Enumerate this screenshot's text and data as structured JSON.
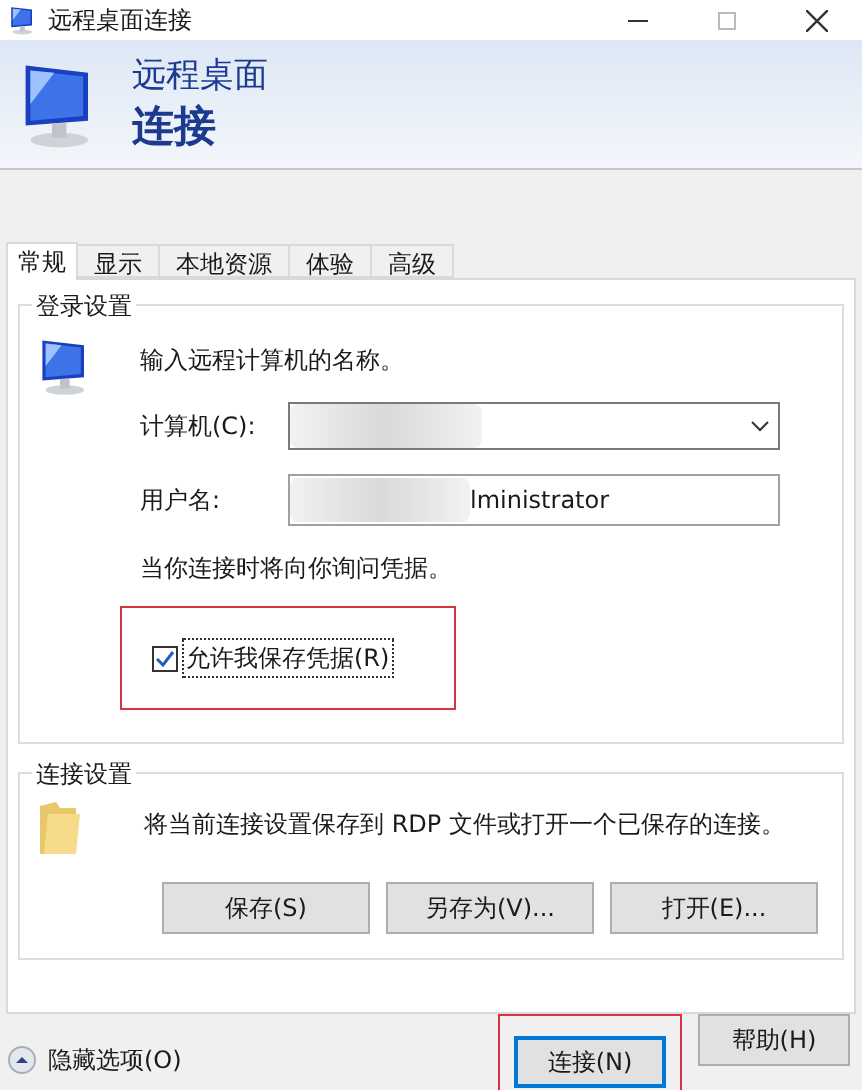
{
  "window": {
    "title": "远程桌面连接"
  },
  "header": {
    "line_1": "远程桌面",
    "line_2": "连接"
  },
  "tabs": [
    {
      "label": "常规",
      "selected": true
    },
    {
      "label": "显示",
      "selected": false
    },
    {
      "label": "本地资源",
      "selected": false
    },
    {
      "label": "体验",
      "selected": false
    },
    {
      "label": "高级",
      "selected": false
    }
  ],
  "login_settings": {
    "title": "登录设置",
    "prompt": "输入远程计算机的名称。",
    "computer": {
      "label": "计算机(C):",
      "redacted": true
    },
    "username": {
      "label": "用户名:",
      "value": "lministrator",
      "redacted": true
    },
    "note": "当你连接时将向你询问凭据。",
    "save_credentials": {
      "label": "允许我保存凭据(R)",
      "checked": true,
      "highlighted": true
    }
  },
  "connection_settings": {
    "title": "连接设置",
    "text": "将当前连接设置保存到 RDP 文件或打开一个已保存的连接。",
    "buttons": [
      {
        "label": "保存(S)"
      },
      {
        "label": "另存为(V)..."
      },
      {
        "label": "打开(E)..."
      }
    ]
  },
  "footer": {
    "options": "隐藏选项(O)",
    "buttons": [
      {
        "label": "连接(N)",
        "default": true,
        "highlighted": true
      },
      {
        "label": "帮助(H)",
        "default": false,
        "highlighted": false
      }
    ]
  }
}
